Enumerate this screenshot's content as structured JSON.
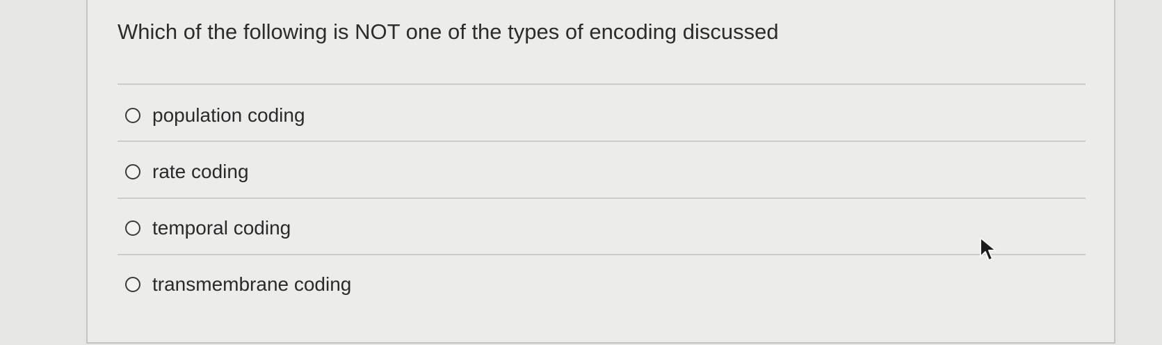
{
  "question": {
    "text": "Which of the following is NOT one of the types of encoding discussed"
  },
  "answers": [
    {
      "label": "population coding"
    },
    {
      "label": "rate coding"
    },
    {
      "label": "temporal coding"
    },
    {
      "label": "transmembrane coding"
    }
  ]
}
